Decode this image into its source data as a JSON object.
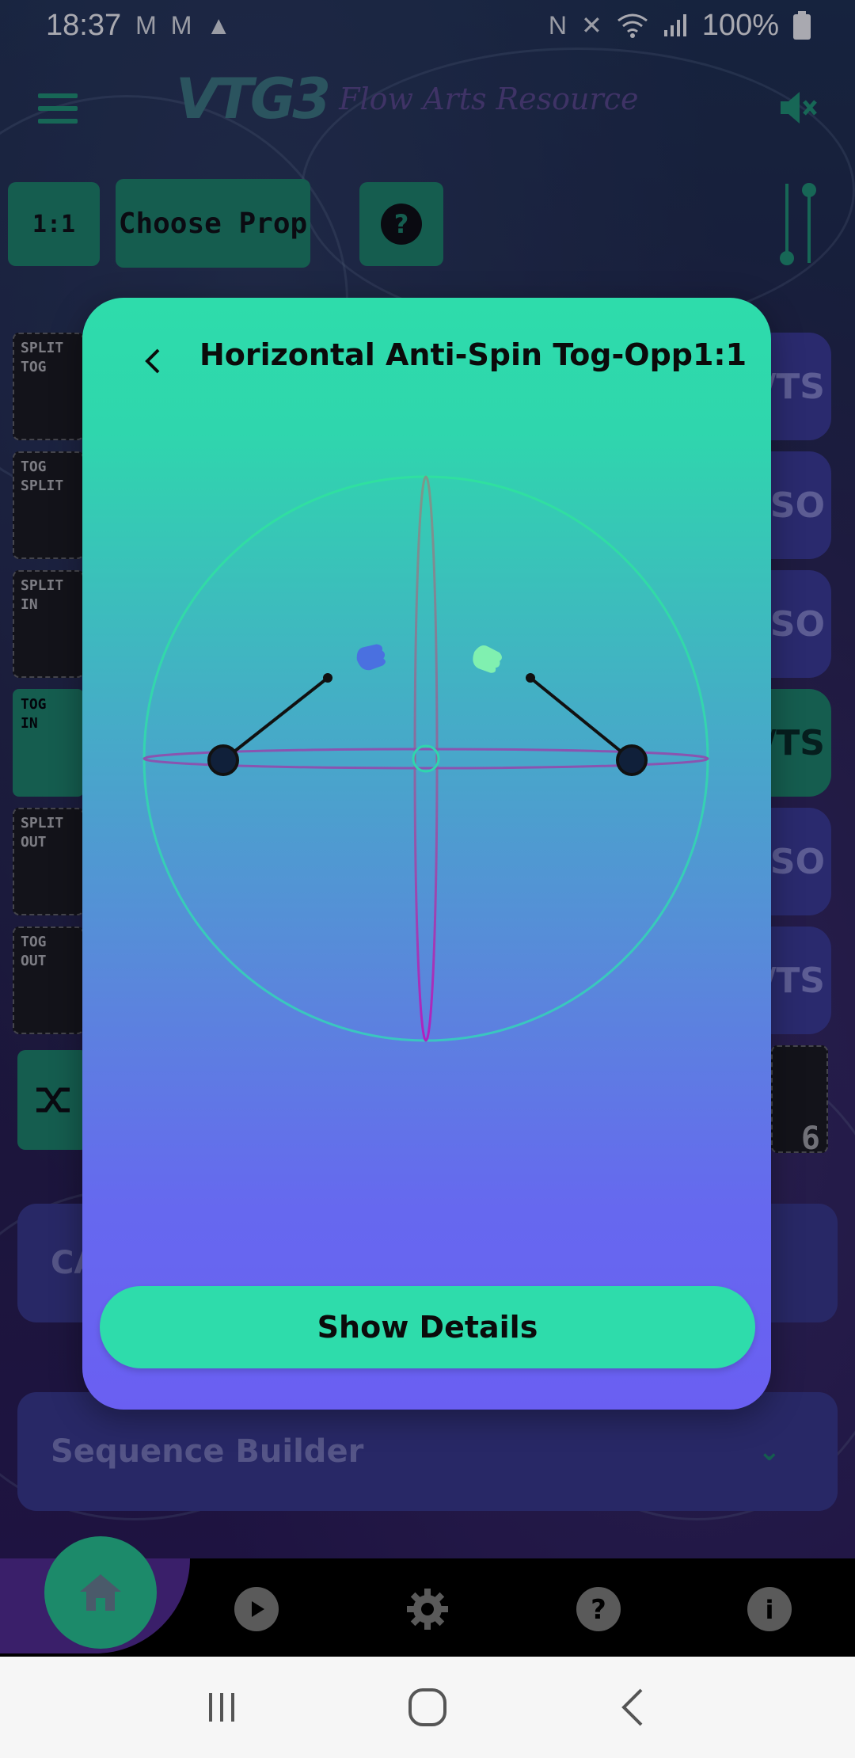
{
  "status_bar": {
    "time": "18:37",
    "left_icons": [
      "gmail-icon",
      "gmail-icon",
      "warning-icon"
    ],
    "right_icons": [
      "nfc-icon",
      "mute-icon",
      "wifi-icon",
      "signal-icon",
      "battery-icon"
    ],
    "battery": "100%"
  },
  "header": {
    "logo": "VTG3",
    "subtitle": "Flow Arts Resource"
  },
  "toolbar": {
    "ratio_label": "1:1",
    "choose_prop_label": "Choose Prop",
    "help_icon": "question-icon"
  },
  "left_cards": [
    {
      "line1": "SPLIT",
      "line2": "TOG"
    },
    {
      "line1": "TOG",
      "line2": "SPLIT"
    },
    {
      "line1": "SPLIT",
      "line2": "IN"
    },
    {
      "line1": "TOG",
      "line2": "IN"
    },
    {
      "line1": "SPLIT",
      "line2": "OUT"
    },
    {
      "line1": "TOG",
      "line2": "OUT"
    }
  ],
  "right_tabs": [
    "/TS",
    "/SO",
    "/SO",
    "/TS",
    "/SO",
    "/TS"
  ],
  "right_card_number": "6",
  "sections": {
    "cards_partial": "CA",
    "sequence_builder": "Sequence Builder"
  },
  "bottom_nav": [
    "home-icon",
    "play-icon",
    "gear-icon",
    "help-icon",
    "info-icon"
  ],
  "modal": {
    "title": "Horizontal Anti-Spin Tog-Opp1:1",
    "details_button": "Show Details"
  },
  "colors": {
    "accent": "#2edcab",
    "modal_bottom": "#6a5ff2",
    "plane_circle": "#2fd6ad",
    "axis": "#9b2fc0"
  }
}
